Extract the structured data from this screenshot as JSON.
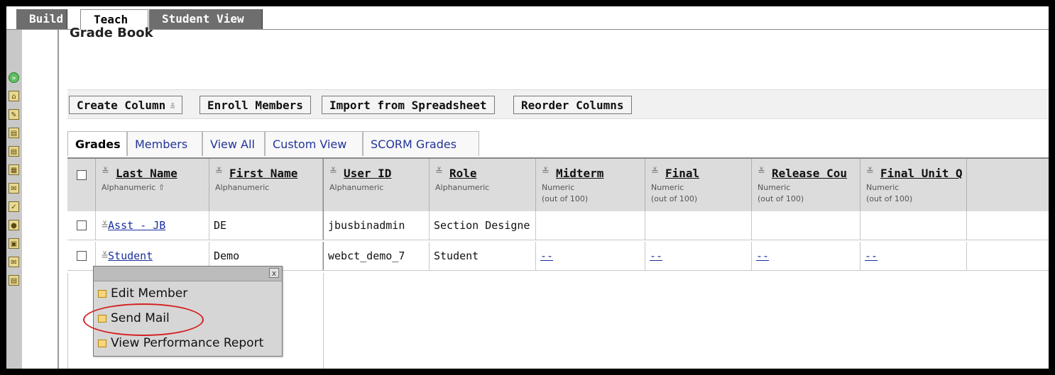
{
  "tabs": [
    {
      "label": "Build",
      "active": false
    },
    {
      "label": "Teach",
      "active": true
    },
    {
      "label": "Student View",
      "active": false
    }
  ],
  "page_title": "Grade Book",
  "toolbar": {
    "create_column": "Create Column",
    "enroll_members": "Enroll Members",
    "import_spreadsheet": "Import from Spreadsheet",
    "reorder_columns": "Reorder Columns"
  },
  "subtabs": [
    {
      "label": "Grades",
      "active": true
    },
    {
      "label": "Members",
      "active": false
    },
    {
      "label": "View All",
      "active": false
    },
    {
      "label": "Custom View",
      "active": false
    },
    {
      "label": "SCORM Grades",
      "active": false
    }
  ],
  "columns": [
    {
      "title": "Last Name",
      "type": "Alphanumeric",
      "sub": ""
    },
    {
      "title": "First Name",
      "type": "Alphanumeric",
      "sub": ""
    },
    {
      "title": "User ID",
      "type": "Alphanumeric",
      "sub": ""
    },
    {
      "title": "Role",
      "type": "Alphanumeric",
      "sub": ""
    },
    {
      "title": "Midterm",
      "type": "Numeric",
      "sub": "(out of 100)"
    },
    {
      "title": "Final",
      "type": "Numeric",
      "sub": "(out of 100)"
    },
    {
      "title": "Release Cou",
      "type": "Numeric",
      "sub": "(out of 100)"
    },
    {
      "title": "Final Unit Q",
      "type": "Numeric",
      "sub": "(out of 100)"
    }
  ],
  "rows": [
    {
      "last": "Asst - JB",
      "first": "DE",
      "userid": "jbusbinadmin",
      "role": "Section Designe",
      "midterm": "",
      "final": "",
      "release": "",
      "finalunit": ""
    },
    {
      "last": "Student",
      "first": "Demo",
      "userid": "webct_demo_7",
      "role": "Student",
      "midterm": "--",
      "final": "--",
      "release": "--",
      "finalunit": "--"
    }
  ],
  "popup_menu": {
    "close_label": "x",
    "items": [
      {
        "label": "Edit Member",
        "icon": "edit-member-icon"
      },
      {
        "label": "Send Mail",
        "icon": "mail-icon",
        "highlighted": true
      },
      {
        "label": "View Performance Report",
        "icon": "report-icon"
      }
    ]
  },
  "colors": {
    "highlight_circle": "#d42020",
    "link": "#1a2ea0",
    "header_bg": "#dcdcdc"
  }
}
